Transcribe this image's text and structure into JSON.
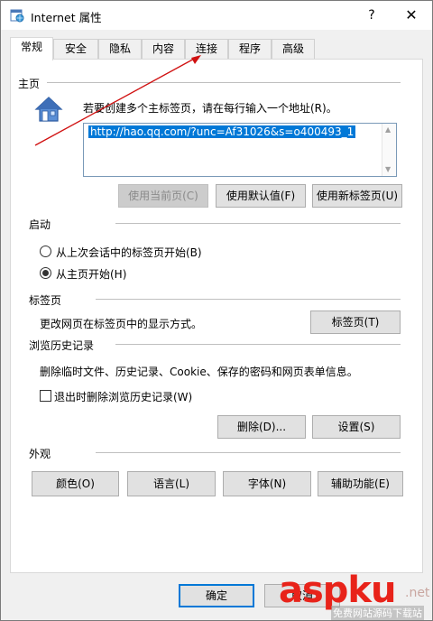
{
  "window": {
    "title": "Internet 属性",
    "help": "?",
    "close": "✕"
  },
  "tabs": [
    {
      "label": "常规",
      "active": true
    },
    {
      "label": "安全",
      "active": false
    },
    {
      "label": "隐私",
      "active": false
    },
    {
      "label": "内容",
      "active": false
    },
    {
      "label": "连接",
      "active": false
    },
    {
      "label": "程序",
      "active": false
    },
    {
      "label": "高级",
      "active": false
    }
  ],
  "homepage": {
    "section": "主页",
    "instruction": "若要创建多个主标签页，请在每行输入一个地址(R)。",
    "url": "http://hao.qq.com/?unc=Af31026&s=o400493_1",
    "btn_current": "使用当前页(C)",
    "btn_default": "使用默认值(F)",
    "btn_newtab": "使用新标签页(U)"
  },
  "startup": {
    "section": "启动",
    "option_last": "从上次会话中的标签页开始(B)",
    "option_home": "从主页开始(H)",
    "selected": "option_home"
  },
  "tabs_section": {
    "section": "标签页",
    "description": "更改网页在标签页中的显示方式。",
    "btn": "标签页(T)"
  },
  "history": {
    "section": "浏览历史记录",
    "description": "删除临时文件、历史记录、Cookie、保存的密码和网页表单信息。",
    "checkbox": "退出时删除浏览历史记录(W)",
    "checked": false,
    "btn_delete": "删除(D)...",
    "btn_settings": "设置(S)"
  },
  "appearance": {
    "section": "外观",
    "btn_colors": "颜色(O)",
    "btn_languages": "语言(L)",
    "btn_fonts": "字体(N)",
    "btn_accessibility": "辅助功能(E)"
  },
  "footer": {
    "ok": "确定",
    "cancel": "取消"
  },
  "watermark": {
    "brand": "aspku",
    "suffix": ".net",
    "tagline": "免费网站源码下载站"
  },
  "colors": {
    "accent": "#0078d7",
    "watermark_red": "#e8231a",
    "annotation_arrow": "#d01010"
  },
  "icons": {
    "app": "internet-options-icon",
    "home": "house-icon"
  }
}
